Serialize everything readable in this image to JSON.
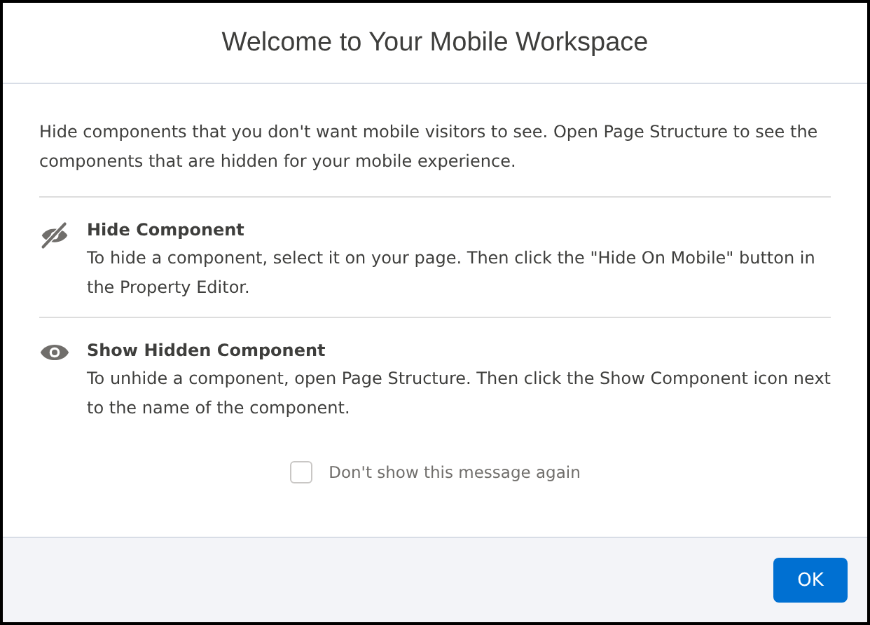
{
  "dialog": {
    "title": "Welcome to Your Mobile Workspace",
    "intro": "Hide components that you don't want mobile visitors to see. Open Page Structure to see the components that are hidden for your mobile experience.",
    "sections": [
      {
        "kind": "hide",
        "heading": "Hide Component",
        "body": "To hide a component, select it on your page. Then click the \"Hide On Mobile\" button in the Property Editor."
      },
      {
        "kind": "show",
        "heading": "Show Hidden Component",
        "body": "To unhide a component, open Page Structure. Then click the Show Component icon next to the name of the component."
      }
    ],
    "checkbox": {
      "label": "Don't show this message again",
      "checked": false
    },
    "buttons": [
      "OK"
    ]
  }
}
